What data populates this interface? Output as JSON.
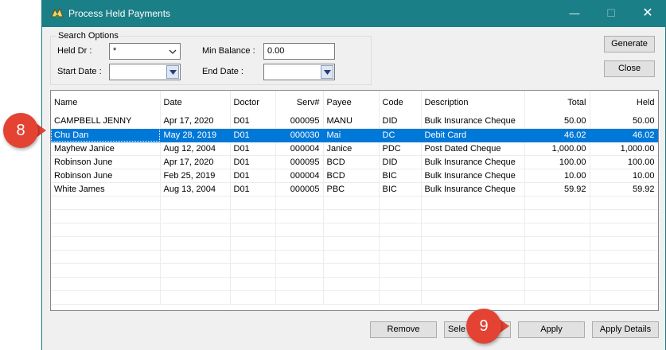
{
  "window": {
    "title": "Process Held Payments",
    "close_glyph": "✕",
    "min_glyph": "—",
    "max_glyph": "☐"
  },
  "search": {
    "group_label": "Search Options",
    "held_dr_label": "Held Dr :",
    "held_dr_value": "*",
    "min_balance_label": "Min Balance :",
    "min_balance_value": "0.00",
    "start_date_label": "Start Date :",
    "start_date_value": "",
    "end_date_label": "End Date :",
    "end_date_value": ""
  },
  "buttons": {
    "generate": "Generate",
    "close": "Close",
    "remove": "Remove",
    "select": "Sele",
    "apply": "Apply",
    "apply_details": "Apply Details"
  },
  "table": {
    "columns": [
      "Name",
      "Date",
      "Doctor",
      "Serv#",
      "Payee",
      "Code",
      "Description",
      "Total",
      "Held"
    ],
    "rows": [
      [
        "CAMPBELL JENNY",
        "Apr 17, 2020",
        "D01",
        "000095",
        "MANU",
        "DID",
        "Bulk Insurance Cheque",
        "50.00",
        "50.00"
      ],
      [
        "Chu Dan",
        "May 28, 2019",
        "D01",
        "000030",
        "Mai",
        "DC",
        "Debit Card",
        "46.02",
        "46.02"
      ],
      [
        "Mayhew Janice",
        "Aug 12, 2004",
        "D01",
        "000004",
        "Janice",
        "PDC",
        "Post Dated Cheque",
        "1,000.00",
        "1,000.00"
      ],
      [
        "Robinson June",
        "Apr 17, 2020",
        "D01",
        "000095",
        "BCD",
        "DID",
        "Bulk Insurance Cheque",
        "100.00",
        "100.00"
      ],
      [
        "Robinson June",
        "Feb 25, 2019",
        "D01",
        "000004",
        "BCD",
        "BIC",
        "Bulk Insurance Cheque",
        "10.00",
        "10.00"
      ],
      [
        "White James",
        "Aug 13, 2004",
        "D01",
        "000005",
        "PBC",
        "BIC",
        "Bulk Insurance Cheque",
        "59.92",
        "59.92"
      ]
    ],
    "selected_row": 1
  },
  "annotations": {
    "step8": "8",
    "step9": "9"
  },
  "colors": {
    "titlebar": "#1a7f86",
    "selection": "#0078d7",
    "badge": "#e44232"
  },
  "icons": [
    "app-icon",
    "chevron-down-icon",
    "calendar-dropdown-icon",
    "minimize-icon",
    "maximize-icon",
    "close-icon"
  ]
}
